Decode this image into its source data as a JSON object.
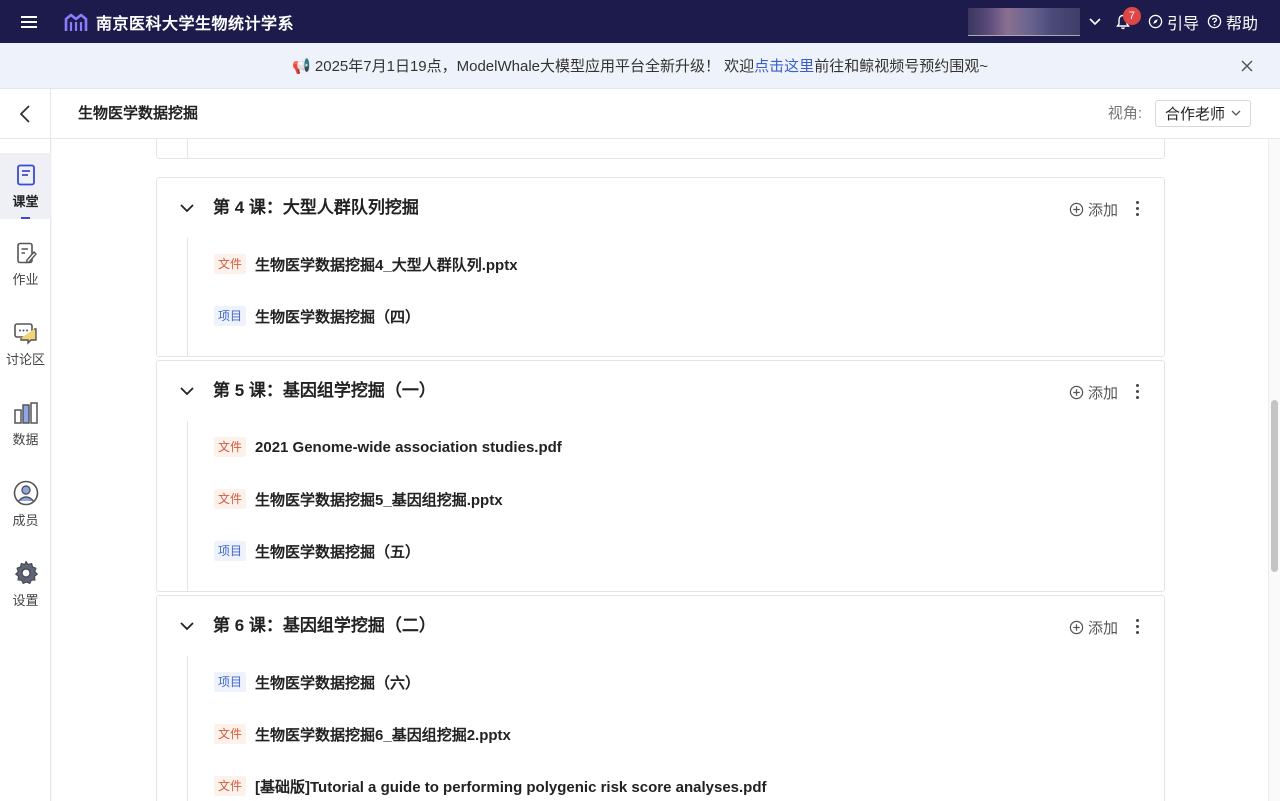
{
  "topbar": {
    "org_name": "南京医科大学生物统计学系",
    "notification_count": "7",
    "guide_label": "引导",
    "help_label": "帮助"
  },
  "announcement": {
    "icon": "megaphone-icon",
    "text_before": "📢 2025年7月1日19点，ModelWhale大模型应用平台全新升级！ 欢迎",
    "link_text": "点击这里",
    "text_after": "前往和鲸视频号预约围观~"
  },
  "header": {
    "course_title": "生物医学数据挖掘",
    "view_label": "视角:",
    "view_value": "合作老师"
  },
  "sidebar": {
    "items": [
      {
        "label": "课堂",
        "icon": "classroom-icon"
      },
      {
        "label": "作业",
        "icon": "homework-icon"
      },
      {
        "label": "讨论区",
        "icon": "discussion-icon"
      },
      {
        "label": "数据",
        "icon": "data-icon"
      },
      {
        "label": "成员",
        "icon": "member-icon"
      },
      {
        "label": "设置",
        "icon": "settings-icon"
      }
    ]
  },
  "lessons": [
    {
      "title": "第 4 课：大型人群队列挖掘",
      "add_label": "添加",
      "items": [
        {
          "tag": "文件",
          "type": "file",
          "name": "生物医学数据挖掘4_大型人群队列.pptx"
        },
        {
          "tag": "项目",
          "type": "project",
          "name": "生物医学数据挖掘（四）"
        }
      ]
    },
    {
      "title": "第 5 课：基因组学挖掘（一）",
      "add_label": "添加",
      "items": [
        {
          "tag": "文件",
          "type": "file",
          "name": "2021 Genome-wide association studies.pdf"
        },
        {
          "tag": "文件",
          "type": "file",
          "name": "生物医学数据挖掘5_基因组挖掘.pptx"
        },
        {
          "tag": "项目",
          "type": "project",
          "name": "生物医学数据挖掘（五）"
        }
      ]
    },
    {
      "title": "第 6 课：基因组学挖掘（二）",
      "add_label": "添加",
      "items": [
        {
          "tag": "项目",
          "type": "project",
          "name": "生物医学数据挖掘（六）"
        },
        {
          "tag": "文件",
          "type": "file",
          "name": "生物医学数据挖掘6_基因组挖掘2.pptx"
        },
        {
          "tag": "文件",
          "type": "file",
          "name": "[基础版]Tutorial a guide to performing polygenic risk score analyses.pdf"
        }
      ]
    }
  ],
  "colors": {
    "topbar_bg": "#1d1b4b",
    "accent": "#3a4ad4",
    "file_tag": "#d55a3c",
    "project_tag": "#4466c8"
  }
}
